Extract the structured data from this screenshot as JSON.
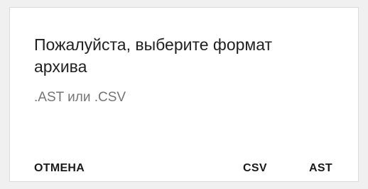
{
  "dialog": {
    "title": "Пожалуйста, выберите формат архива",
    "subtitle": ".AST или .CSV",
    "actions": {
      "cancel_label": "ОТМЕНА",
      "csv_label": "CSV",
      "ast_label": "AST"
    }
  }
}
